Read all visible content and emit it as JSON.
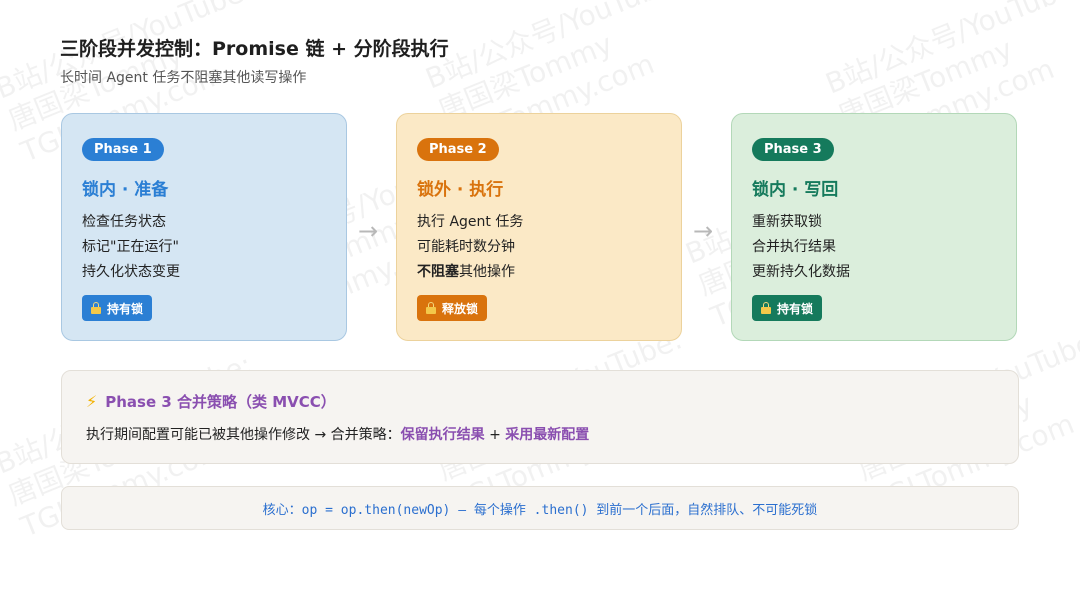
{
  "header": {
    "title": "三阶段并发控制：Promise 链 + 分阶段执行",
    "subtitle": "长时间 Agent 任务不阻塞其他读写操作"
  },
  "phases": [
    {
      "badge": "Phase 1",
      "heading": "锁内 · 准备",
      "lines": [
        "检查任务状态",
        "标记\"正在运行\"",
        "持久化状态变更"
      ],
      "lock_label": "持有锁",
      "color": "#2b7fd4"
    },
    {
      "badge": "Phase 2",
      "heading": "锁外 · 执行",
      "lines": [
        "执行 Agent 任务",
        "可能耗时数分钟"
      ],
      "line3_bold": "不阻塞",
      "line3_rest": "其他操作",
      "lock_label": "释放锁",
      "color": "#d9730d"
    },
    {
      "badge": "Phase 3",
      "heading": "锁内 · 写回",
      "lines": [
        "重新获取锁",
        "合并执行结果",
        "更新持久化数据"
      ],
      "lock_label": "持有锁",
      "color": "#157a5c"
    }
  ],
  "arrows": [
    "→",
    "→"
  ],
  "strategy": {
    "icon": "lightning-icon",
    "title": "Phase 3 合并策略（类 MVCC）",
    "text_prefix": "执行期间配置可能已被其他操作修改 → 合并策略：",
    "option1": "保留执行结果",
    "plus": "+",
    "option2": "采用最新配置"
  },
  "core": {
    "text": "核心：op = op.then(newOp) — 每个操作 .then() 到前一个后面，自然排队、不可能死锁"
  },
  "watermarks": {
    "line1": "B站/公众号/YouTube:",
    "line2": "唐国梁Tommy",
    "line3": "TGLTommy.com"
  }
}
